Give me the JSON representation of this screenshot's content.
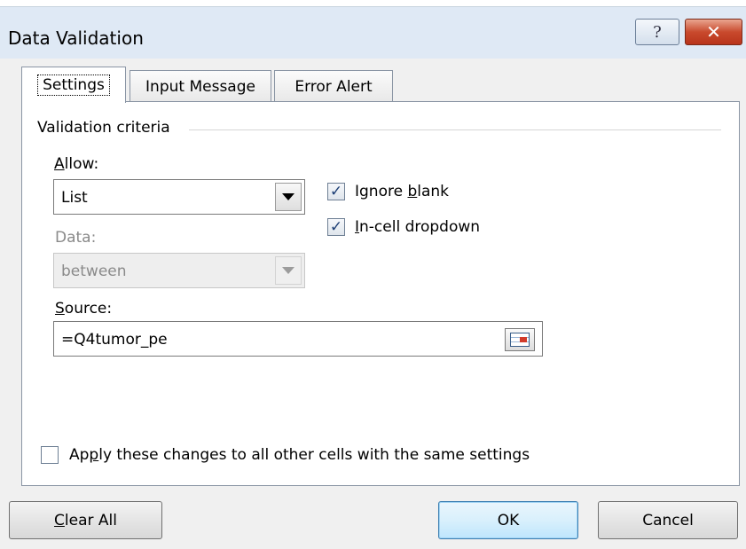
{
  "dialog": {
    "title": "Data Validation",
    "help_label": "?",
    "close_label": "✕"
  },
  "tabs": [
    {
      "label": "Settings",
      "selected": true
    },
    {
      "label": "Input Message",
      "selected": false
    },
    {
      "label": "Error Alert",
      "selected": false
    }
  ],
  "criteria": {
    "group_label": "Validation criteria",
    "allow": {
      "label_u": "A",
      "label_rest": "llow:",
      "value": "List"
    },
    "data": {
      "label": "Data:",
      "value": "between",
      "disabled": true
    },
    "ignore_blank": {
      "label_pre": "Ignore ",
      "label_u": "b",
      "label_rest": "lank",
      "checked": true
    },
    "in_cell_dropdown": {
      "label_u": "I",
      "label_rest": "n-cell dropdown",
      "checked": true
    },
    "source": {
      "label_u": "S",
      "label_rest": "ource:",
      "value": "=Q4tumor_pe"
    }
  },
  "apply_all": {
    "label_pre": "Ap",
    "label_u": "p",
    "label_rest": "ly these changes to all other cells with the same settings",
    "checked": false
  },
  "buttons": {
    "clear_u": "C",
    "clear_rest": "lear All",
    "ok": "OK",
    "cancel": "Cancel"
  },
  "colors": {
    "titlebar": "#dfe9f5",
    "close_button": "#c94a2d",
    "check_mark": "#1d3e75"
  }
}
